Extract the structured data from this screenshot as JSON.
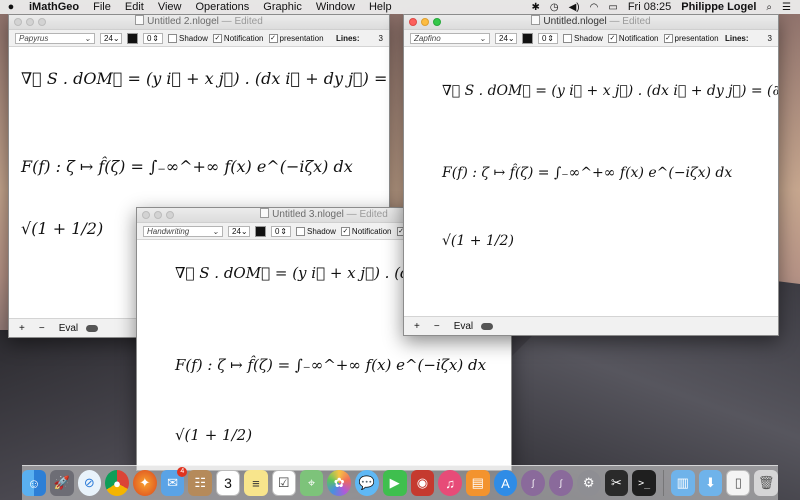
{
  "menubar": {
    "app_name": "iMathGeo",
    "items": [
      "File",
      "Edit",
      "View",
      "Operations",
      "Graphic",
      "Window",
      "Help"
    ],
    "clock": "Fri 08:25",
    "user": "Philippe Logel"
  },
  "windows": [
    {
      "title": "Untitled 2.nlogel",
      "edited": "— Edited",
      "font": "Papyrus",
      "size": "24",
      "number": "0",
      "shadow_label": "Shadow",
      "notification_label": "Notification",
      "presentation_label": "presentation",
      "lines_label": "Lines:",
      "lines_value": "3",
      "formulas": [
        "∇⃗ S . dOM⃗ = (y i⃗ + x j⃗) . (dx i⃗ + dy j⃗) = (∂(xy)/∂x i⃗ + ∂(",
        "F(f) : ζ ↦ f̂(ζ) = ∫₋∞^+∞ f(x) e^(−iζx) dx",
        "√(1 + 1/2)"
      ],
      "add_label": "+",
      "remove_label": "−",
      "eval_label": "Eval"
    },
    {
      "title": "Untitled.nlogel",
      "edited": "— Edited",
      "font": "Zapfino",
      "size": "24",
      "number": "0",
      "shadow_label": "Shadow",
      "notification_label": "Notification",
      "presentation_label": "presentation",
      "lines_label": "Lines:",
      "lines_value": "3",
      "formulas": [
        "∇⃗ S . dOM⃗ = (y i⃗ + x j⃗) . (dx i⃗ + dy j⃗) = (∂(xy)/∂x i⃗ +",
        "F(f) : ζ ↦ f̂(ζ) = ∫₋∞^+∞ f(x) e^(−iζx) dx",
        "√(1 + 1/2)"
      ],
      "add_label": "+",
      "remove_label": "−",
      "eval_label": "Eval"
    },
    {
      "title": "Untitled 3.nlogel",
      "edited": "— Edited",
      "font": "Handwriting",
      "size": "24",
      "number": "0",
      "shadow_label": "Shadow",
      "notification_label": "Notification",
      "presentation_label": "presentation",
      "formulas": [
        "∇⃗ S . dOM⃗ = (y i⃗ + x j⃗) . (dx i⃗ + (",
        "F(f) : ζ ↦ f̂(ζ) = ∫₋∞^+∞ f(x) e^(−iζx) dx",
        "√(1 + 1/2)"
      ]
    }
  ],
  "dock": {
    "mail_badge": "4",
    "calendar_day": "3",
    "items": [
      "finder",
      "launchpad",
      "safari",
      "chrome",
      "firefox",
      "mail",
      "contacts",
      "calendar",
      "notes",
      "reminders",
      "maps",
      "photos",
      "messages",
      "facetime",
      "photo-booth",
      "itunes",
      "ibooks",
      "app-store",
      "imathgeo",
      "imathgeo",
      "system-preferences",
      "final-cut",
      "terminal",
      "applications-folder",
      "downloads-folder",
      "document",
      "trash"
    ]
  }
}
